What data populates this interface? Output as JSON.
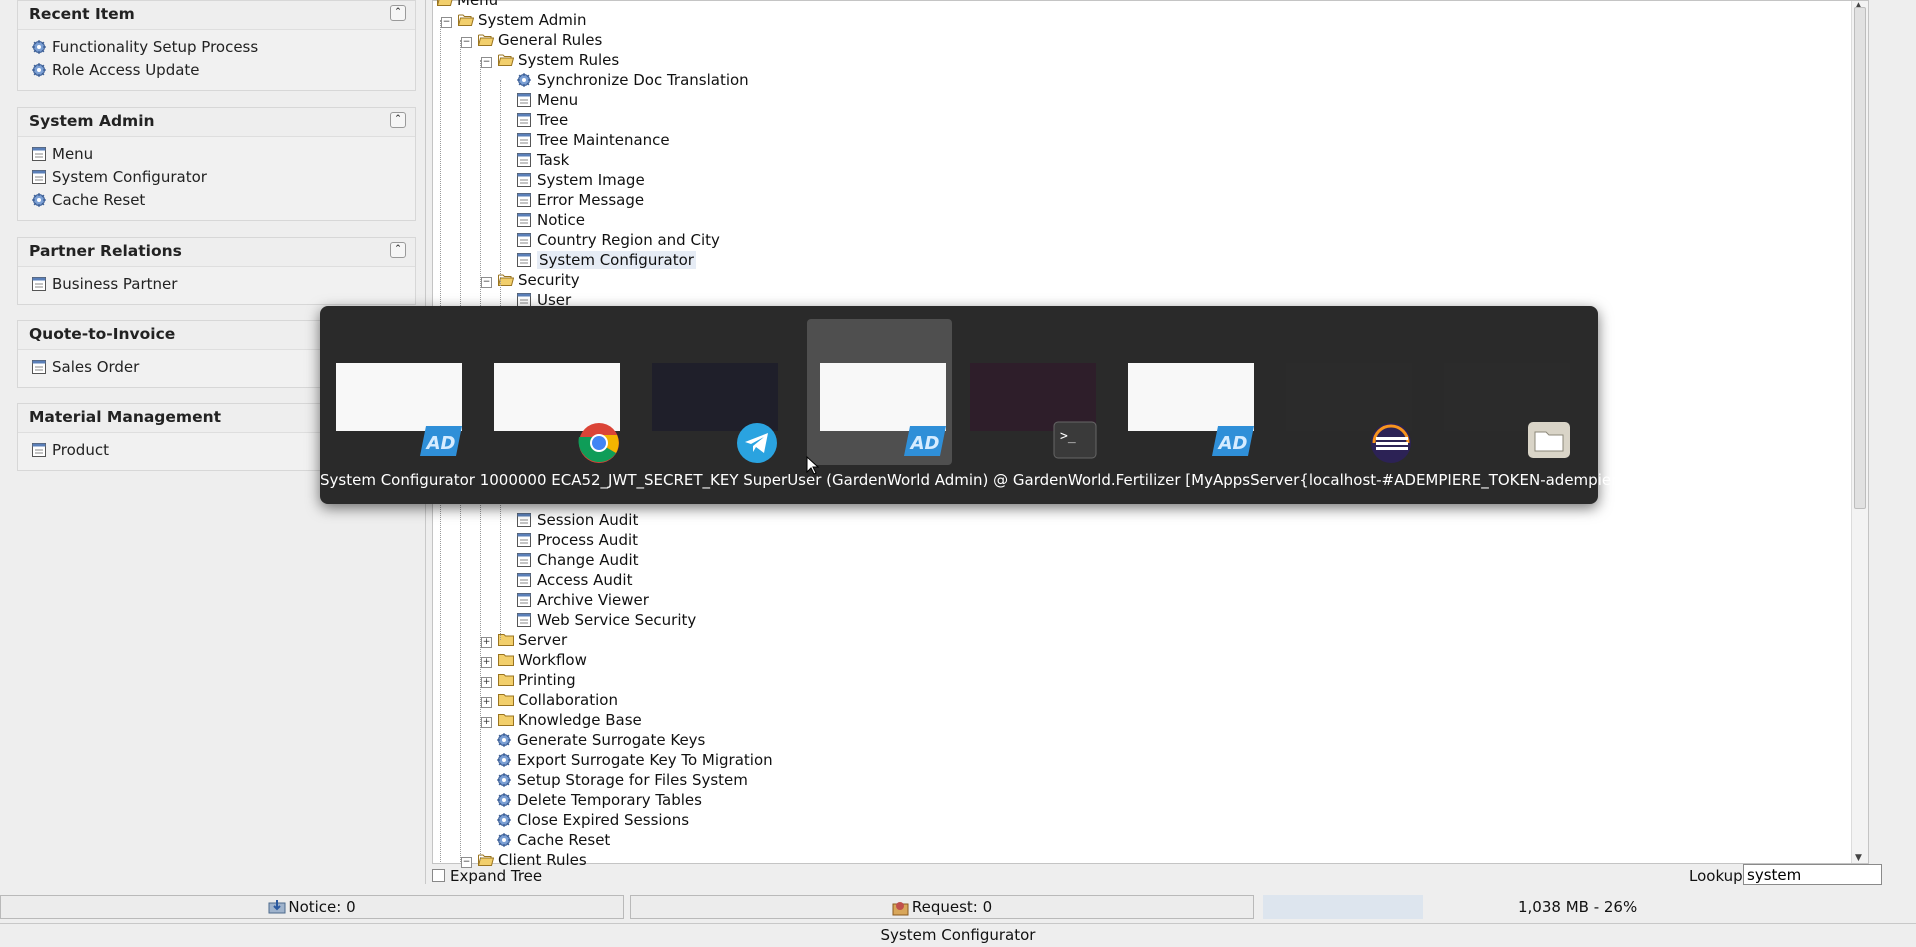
{
  "sidebar": {
    "panels": [
      {
        "title": "Recent Item",
        "items": [
          {
            "label": "Functionality Setup Process",
            "icon": "process-gear-icon"
          },
          {
            "label": "Role Access Update",
            "icon": "process-gear-icon"
          }
        ]
      },
      {
        "title": "System Admin",
        "items": [
          {
            "label": "Menu",
            "icon": "window-icon"
          },
          {
            "label": "System Configurator",
            "icon": "window-icon"
          },
          {
            "label": "Cache Reset",
            "icon": "process-gear-icon"
          }
        ]
      },
      {
        "title": "Partner Relations",
        "items": [
          {
            "label": "Business Partner",
            "icon": "window-icon"
          }
        ]
      },
      {
        "title": "Quote-to-Invoice",
        "items": [
          {
            "label": "Sales Order",
            "icon": "window-icon"
          }
        ]
      },
      {
        "title": "Material Management",
        "items": [
          {
            "label": "Product",
            "icon": "window-icon"
          }
        ]
      }
    ]
  },
  "tree": {
    "nodes": [
      {
        "label": "Menu",
        "type": "folder-open"
      },
      {
        "label": "System Admin",
        "type": "folder-open",
        "expander": "⊟"
      },
      {
        "label": "General Rules",
        "type": "folder-open",
        "expander": "⊟"
      },
      {
        "label": "System Rules",
        "type": "folder-open",
        "expander": "⊟"
      },
      {
        "label": "Synchronize Doc Translation",
        "type": "process"
      },
      {
        "label": "Menu",
        "type": "window"
      },
      {
        "label": "Tree",
        "type": "window"
      },
      {
        "label": "Tree Maintenance",
        "type": "window"
      },
      {
        "label": "Task",
        "type": "window"
      },
      {
        "label": "System Image",
        "type": "window"
      },
      {
        "label": "Error Message",
        "type": "window"
      },
      {
        "label": "Notice",
        "type": "window"
      },
      {
        "label": "Country Region and City",
        "type": "window"
      },
      {
        "label": "System Configurator",
        "type": "window",
        "selected": true
      },
      {
        "label": "Security",
        "type": "folder-open",
        "expander": "⊟"
      },
      {
        "label": "User",
        "type": "window"
      },
      {
        "label": "Session Audit",
        "type": "window"
      },
      {
        "label": "Process Audit",
        "type": "window"
      },
      {
        "label": "Change Audit",
        "type": "window"
      },
      {
        "label": "Access Audit",
        "type": "window"
      },
      {
        "label": "Archive Viewer",
        "type": "window"
      },
      {
        "label": "Web Service Security",
        "type": "window"
      },
      {
        "label": "Server",
        "type": "folder",
        "expander": "⊞"
      },
      {
        "label": "Workflow",
        "type": "folder",
        "expander": "⊞"
      },
      {
        "label": "Printing",
        "type": "folder",
        "expander": "⊞"
      },
      {
        "label": "Collaboration",
        "type": "folder",
        "expander": "⊞"
      },
      {
        "label": "Knowledge Base",
        "type": "folder",
        "expander": "⊞"
      },
      {
        "label": "Generate Surrogate Keys",
        "type": "process"
      },
      {
        "label": "Export Surrogate Key To Migration",
        "type": "process"
      },
      {
        "label": "Setup Storage for Files System",
        "type": "process"
      },
      {
        "label": "Delete Temporary Tables",
        "type": "process"
      },
      {
        "label": "Close Expired Sessions",
        "type": "process"
      },
      {
        "label": "Cache Reset",
        "type": "process"
      },
      {
        "label": "Client Rules",
        "type": "folder-open",
        "expander": "⊟"
      }
    ]
  },
  "footer": {
    "expand_tree_label": "Expand Tree",
    "lookup_label": "Lookup",
    "lookup_value": "system"
  },
  "status": {
    "notice": "Notice: 0",
    "request": "Request: 0",
    "memory": "1,038 MB - 26%",
    "memory_used_fraction": 0.26,
    "window_title": "System Configurator"
  },
  "switcher": {
    "windows": [
      {
        "app": "iDempiere",
        "icon": "adempiere-icon"
      },
      {
        "app": "Chrome",
        "icon": "chrome-icon"
      },
      {
        "app": "Telegram",
        "icon": "telegram-icon"
      },
      {
        "app": "iDempiere",
        "icon": "adempiere-icon",
        "active": true
      },
      {
        "app": "Terminal",
        "icon": "terminal-icon"
      },
      {
        "app": "iDempiere",
        "icon": "adempiere-icon"
      },
      {
        "app": "Eclipse",
        "icon": "eclipse-icon"
      },
      {
        "app": "Files",
        "icon": "files-icon"
      }
    ],
    "title": "System Configurator  1000000  ECA52_JWT_SECRET_KEY  SuperUser (GardenWorld Admin) @ GardenWorld.Fertilizer [MyAppsServer{localhost-#ADEMPIERE_TOKEN-adempiere}]"
  },
  "colors": {
    "switcher_bg": "#2a2a2a",
    "selection": "#e6ecf5",
    "folder": "#e8c25a",
    "process_icon": "#5a7fb8"
  }
}
